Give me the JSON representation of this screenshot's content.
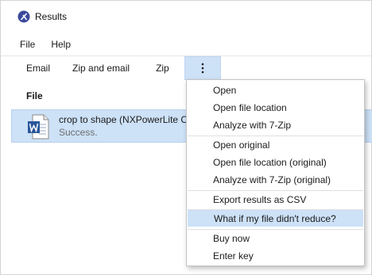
{
  "window": {
    "title": "Results"
  },
  "menubar": {
    "items": [
      "File",
      "Help"
    ]
  },
  "toolbar": {
    "email": "Email",
    "zip_and_email": "Zip and email",
    "zip": "Zip",
    "more_icon": "vertical-ellipsis"
  },
  "table": {
    "column_file": "File"
  },
  "rows": [
    {
      "filename": "crop to shape (NXPowerLite C",
      "status": "Success.",
      "icon": "word-document-icon"
    }
  ],
  "context_menu": {
    "groups": [
      [
        "Open",
        "Open file location",
        "Analyze with 7-Zip"
      ],
      [
        "Open original",
        "Open file location (original)",
        "Analyze with 7-Zip (original)"
      ],
      [
        "Export results as CSV"
      ],
      [
        "What if my file didn't reduce?"
      ],
      [
        "Buy now",
        "Enter key"
      ]
    ],
    "highlighted": "What if my file didn't reduce?"
  },
  "colors": {
    "selection": "#cde1f7",
    "word_blue": "#2b579a"
  }
}
